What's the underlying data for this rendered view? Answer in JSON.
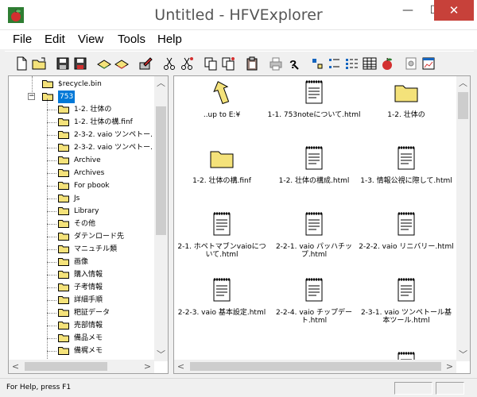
{
  "window": {
    "title": "Untitled - HFVExplorer",
    "minimize_glyph": "—",
    "maximize_glyph": "☐",
    "close_glyph": "✕"
  },
  "menu": [
    "File",
    "Edit",
    "View",
    "Tools",
    "Help"
  ],
  "tree": {
    "items": [
      {
        "label": "$recycle.bin",
        "level": 1,
        "expander": ""
      },
      {
        "label": "753",
        "level": 1,
        "expander": "−",
        "selected": true
      },
      {
        "label": "1-2. 壮体の",
        "level": 2
      },
      {
        "label": "1-2. 壮体の構.finf",
        "level": 2
      },
      {
        "label": "2-3-2. vaio ツンペトー.",
        "level": 2
      },
      {
        "label": "2-3-2. vaio ツンペトー.",
        "level": 2
      },
      {
        "label": "Archive",
        "level": 2
      },
      {
        "label": "Archives",
        "level": 2
      },
      {
        "label": "For pbook",
        "level": 2
      },
      {
        "label": "Js",
        "level": 2
      },
      {
        "label": "Library",
        "level": 2
      },
      {
        "label": "その他",
        "level": 2
      },
      {
        "label": "ダテンロード先",
        "level": 2
      },
      {
        "label": "マニュチル類",
        "level": 2
      },
      {
        "label": "画像",
        "level": 2
      },
      {
        "label": "購入情報",
        "level": 2
      },
      {
        "label": "子考情報",
        "level": 2
      },
      {
        "label": "詳細手順",
        "level": 2
      },
      {
        "label": "粑証データ",
        "level": 2
      },
      {
        "label": "売部情報",
        "level": 2
      },
      {
        "label": "備品メモ",
        "level": 2
      },
      {
        "label": "備梶メモ",
        "level": 2
      }
    ]
  },
  "files": [
    {
      "label": "..up to E:¥",
      "icon": "up-arrow-icon"
    },
    {
      "label": "1-1. 753noteについて.html",
      "icon": "document-icon"
    },
    {
      "label": "1-2. 壮体の",
      "icon": "folder-icon"
    },
    {
      "label": "1-2. 壮体の構.finf",
      "icon": "folder-icon"
    },
    {
      "label": "1-2. 壮体の構成.html",
      "icon": "document-icon"
    },
    {
      "label": "1-3. 情報公視に際して.html",
      "icon": "document-icon"
    },
    {
      "label": "2-1. ホペトマブンvaioについて.html",
      "icon": "document-icon"
    },
    {
      "label": "2-2-1. vaio パッハチップ.html",
      "icon": "document-icon"
    },
    {
      "label": "2-2-2. vaio リニバリー.html",
      "icon": "document-icon"
    },
    {
      "label": "2-2-3. vaio 基本設定.html",
      "icon": "document-icon"
    },
    {
      "label": "2-2-4. vaio チップデート.html",
      "icon": "document-icon"
    },
    {
      "label": "2-3-1. vaio ツンペトール基本ツール.html",
      "icon": "document-icon"
    }
  ],
  "status": {
    "text": "For Help, press F1"
  },
  "colors": {
    "selection": "#0078d7",
    "close_button": "#c7413a",
    "folder": "#f4e27a"
  }
}
